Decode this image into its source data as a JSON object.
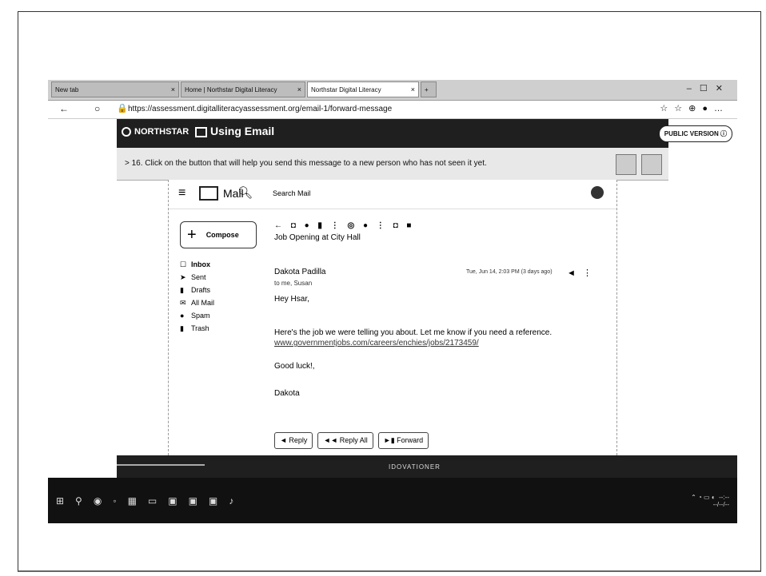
{
  "browser": {
    "tabs": [
      {
        "label": "New tab"
      },
      {
        "label": "Home | Northstar Digital Literacy"
      },
      {
        "label": "Northstar Digital Literacy"
      }
    ],
    "url": "https://assessment.digitalliteracyassessment.org/email-1/forward-message"
  },
  "northstar": {
    "brand": "NORTHSTAR",
    "module": "Using Email",
    "public_version": "PUBLIC VERSION"
  },
  "question": {
    "text": "> 16. Click on the button that will help you send this message to a new person who has not seen it yet."
  },
  "mail": {
    "app_label": "Mail",
    "search_placeholder": "Search Mail",
    "compose_label": "Compose",
    "folders": [
      {
        "label": "Inbox",
        "icon": "inbox-icon"
      },
      {
        "label": "Sent",
        "icon": "sent-icon"
      },
      {
        "label": "Drafts",
        "icon": "drafts-icon"
      },
      {
        "label": "All Mail",
        "icon": "all-mail-icon"
      },
      {
        "label": "Spam",
        "icon": "spam-icon"
      },
      {
        "label": "Trash",
        "icon": "trash-icon"
      }
    ],
    "message": {
      "subject": "Job Opening at City Hall",
      "from": "Dakota Padilla",
      "to": "to me, Susan",
      "date": "Tue, Jun 14, 2:03 PM (3 days ago)",
      "greeting": "Hey Hsar,",
      "body_line": "Here's the job we were telling you about. Let me know if you need a reference.",
      "link": "www.governmentjobs.com/careers/enchies/jobs/2173459/",
      "closing": "Good luck!,",
      "signature": "Dakota"
    },
    "actions": {
      "reply": "Reply",
      "reply_all": "Reply All",
      "forward": "Forward"
    }
  },
  "footer": {
    "label": "IDOVATIONER"
  }
}
